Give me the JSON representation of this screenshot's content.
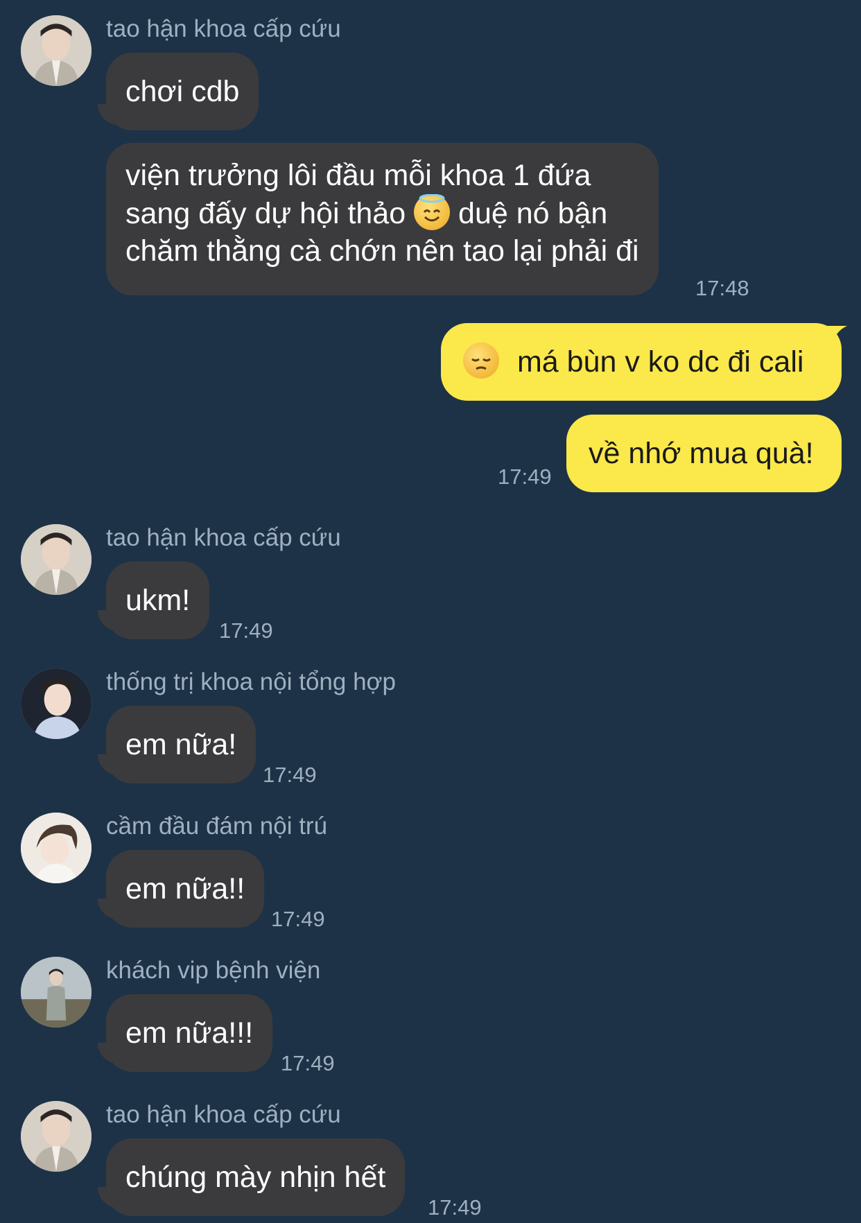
{
  "senders": {
    "s1": "tao hận khoa cấp cứu",
    "s2": "thống trị khoa nội tổng hợp",
    "s3": "cầm đầu đám nội trú",
    "s4": "khách vip bệnh viện"
  },
  "messages": {
    "m1": "chơi cdb",
    "m2_line1": "viện trưởng lôi đầu mỗi khoa 1 đứa",
    "m2_line2a": "sang đấy dự hội thảo",
    "m2_line2b": "duệ nó bận",
    "m2_line3": "chăm thằng cà chớn nên tao lại phải đi",
    "m2_time": "17:48",
    "m3": "má bùn v ko dc đi cali",
    "m4": "về nhớ mua quà!",
    "m4_time": "17:49",
    "m5": "ukm!",
    "m5_time": "17:49",
    "m6": "em nữa!",
    "m6_time": "17:49",
    "m7": "em nữa!!",
    "m7_time": "17:49",
    "m8": "em nữa!!!",
    "m8_time": "17:49",
    "m9": "chúng mày nhịn hết",
    "m9_time": "17:49"
  },
  "icons": {
    "halo_emoji": "smiling-face-with-halo-icon",
    "pensive_emoji": "pensive-face-icon"
  },
  "colors": {
    "background": "#1d3247",
    "incoming_bubble": "#3b3b3d",
    "outgoing_bubble": "#fbe84a",
    "meta_text": "#9fb0c0"
  }
}
